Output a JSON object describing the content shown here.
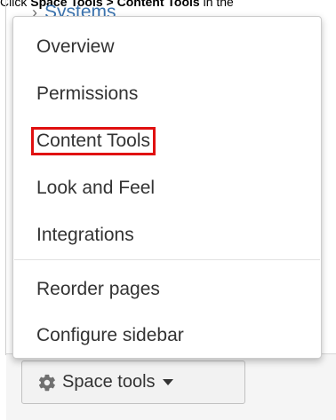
{
  "caption": {
    "prefix": "Click ",
    "bold_text": "Space Tools > Content Tools",
    "suffix": " in the"
  },
  "background_item": {
    "chevron": "›",
    "label": "Systems"
  },
  "menu": {
    "groups": [
      [
        "Overview",
        "Permissions",
        "Content Tools",
        "Look and Feel",
        "Integrations"
      ],
      [
        "Reorder pages",
        "Configure sidebar"
      ]
    ],
    "highlighted": "Content Tools",
    "highlight_color": "#e01010"
  },
  "space_tools_button": {
    "label": "Space tools",
    "icon": "gear-icon",
    "caret_icon": "caret-down-icon"
  }
}
